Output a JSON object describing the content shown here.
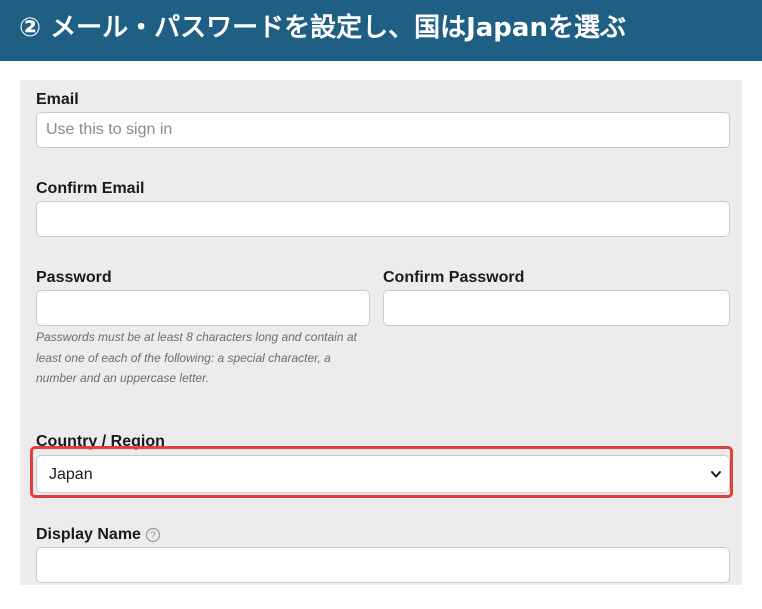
{
  "banner": {
    "title": "② メール・パスワードを設定し、国はJapanを選ぶ"
  },
  "form": {
    "email": {
      "label": "Email",
      "value": "",
      "placeholder": "Use this to sign in"
    },
    "confirm_email": {
      "label": "Confirm Email",
      "value": "",
      "placeholder": ""
    },
    "password": {
      "label": "Password",
      "value": "",
      "placeholder": ""
    },
    "confirm_password": {
      "label": "Confirm Password",
      "value": "",
      "placeholder": ""
    },
    "password_hint": "Passwords must be at least 8 characters long and contain at least one of each of the following: a special character, a number and an uppercase letter.",
    "country": {
      "label": "Country / Region",
      "selected": "Japan",
      "icon": "chevron-down-icon"
    },
    "display_name": {
      "label": "Display Name",
      "value": "",
      "placeholder": "",
      "help_icon": "help-circle-icon"
    }
  },
  "colors": {
    "banner_bg": "#1f5f84",
    "panel_bg": "#edebeb",
    "highlight": "#e0403b"
  }
}
